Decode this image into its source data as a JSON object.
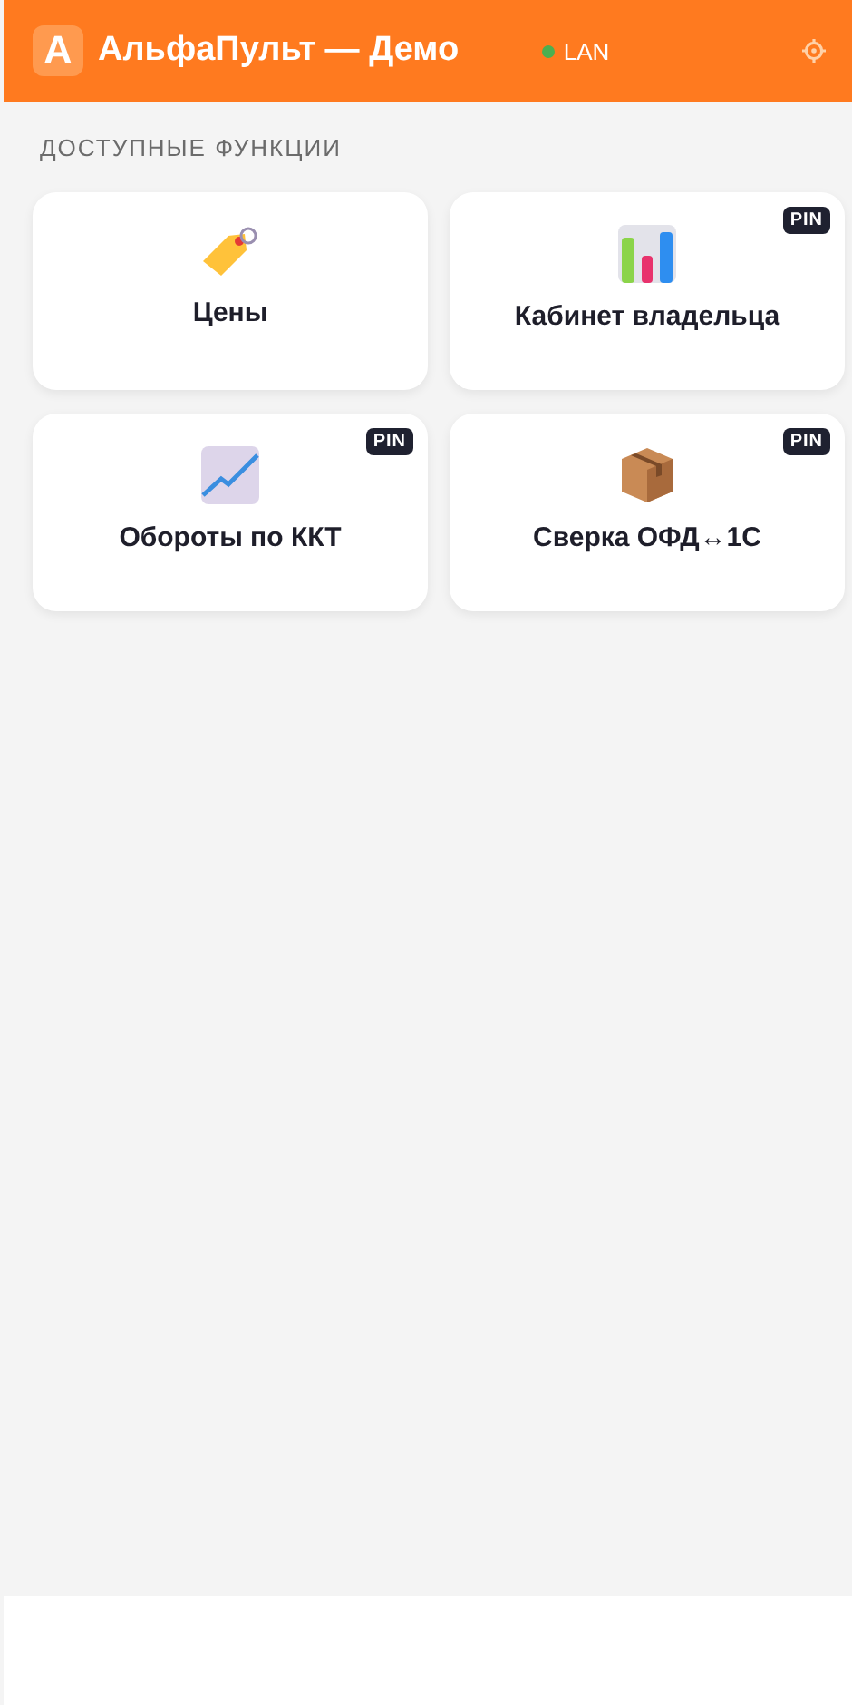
{
  "header": {
    "logo": "A",
    "title": "АльфаПульт — Демо",
    "connection": {
      "label": "LAN",
      "online": true
    }
  },
  "section_title": "ДОСТУПНЫЕ ФУНКЦИИ",
  "functions": [
    {
      "kind": "tag",
      "label": "Цены",
      "pin": false
    },
    {
      "kind": "bars",
      "label": "Кабинет владельца",
      "pin": true,
      "badge": "PIN"
    },
    {
      "kind": "trend",
      "label": "Обороты по ККТ",
      "pin": true,
      "badge": "PIN"
    },
    {
      "kind": "box",
      "label": "Сверка ОФД↔1С",
      "pin": true,
      "badge": "PIN"
    }
  ]
}
